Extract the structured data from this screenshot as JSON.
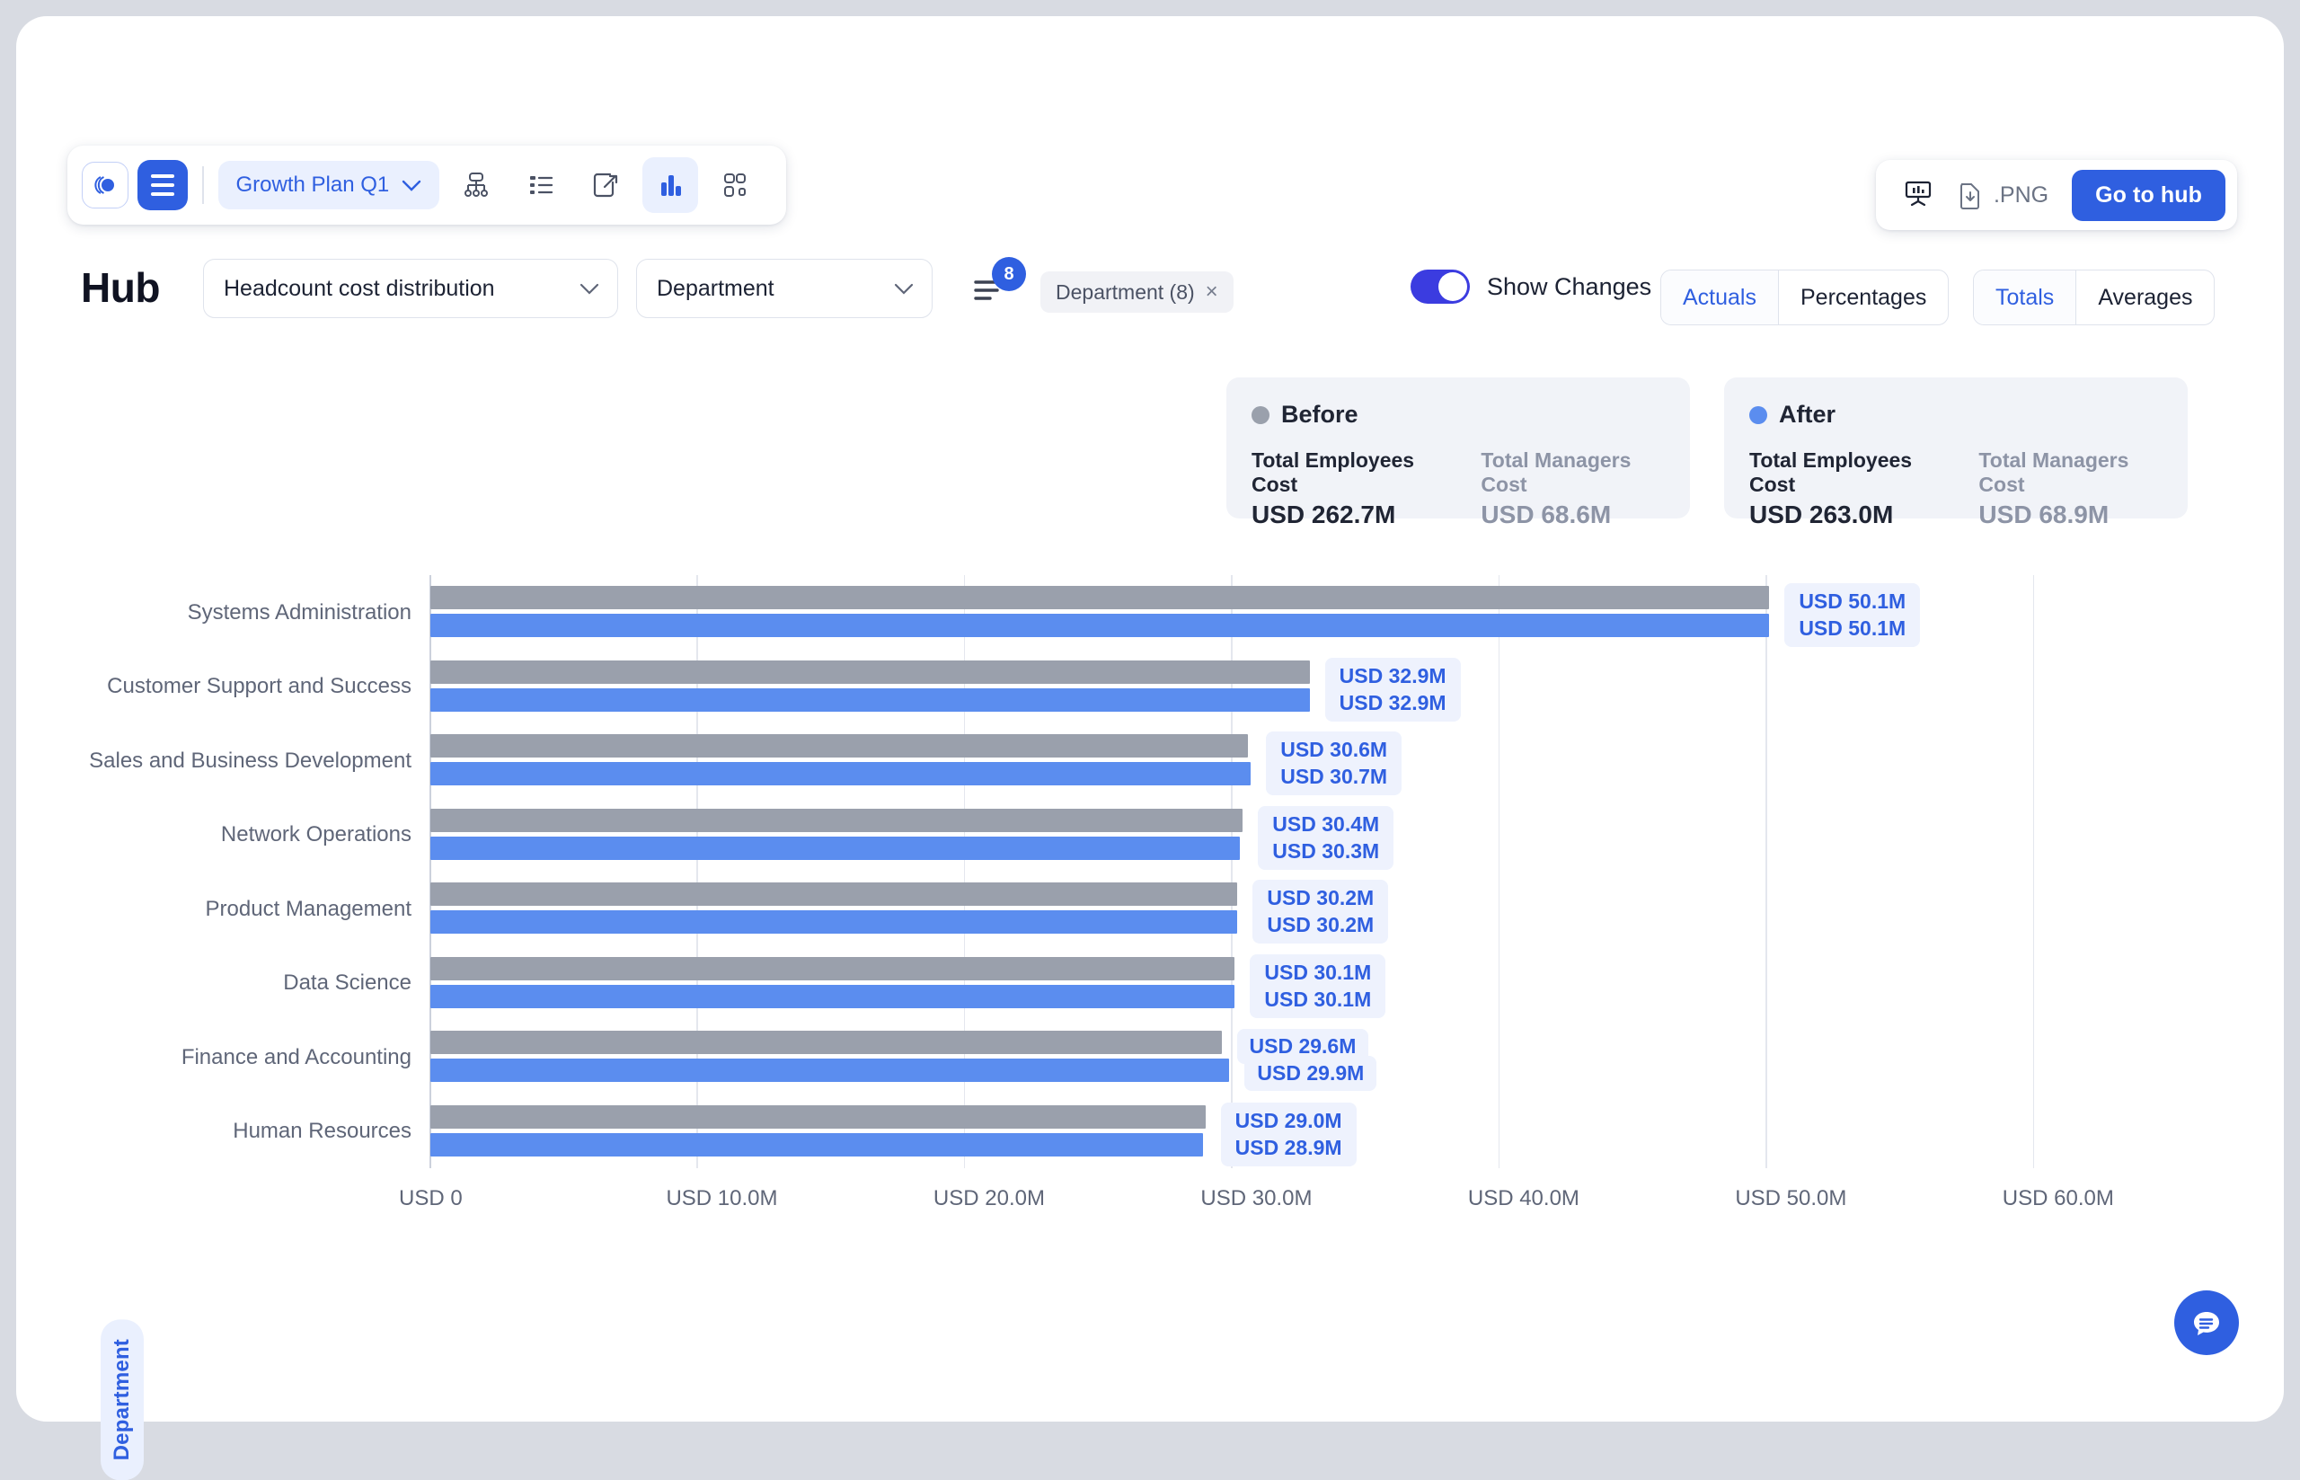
{
  "toolbar": {
    "logo_icon": "brand-logo-icon",
    "menu_icon": "hamburger-menu-icon",
    "plan_label": "Growth Plan Q1",
    "plan_chevron": "chevron-down-icon",
    "icons": [
      {
        "name": "org-chart-icon",
        "active": false
      },
      {
        "name": "list-view-icon",
        "active": false
      },
      {
        "name": "scenario-icon",
        "active": false
      },
      {
        "name": "bar-chart-icon",
        "active": true
      },
      {
        "name": "group-nodes-icon",
        "active": false
      }
    ]
  },
  "top_actions": {
    "present_icon": "presentation-icon",
    "download_icon": "file-download-icon",
    "png_label": ".PNG",
    "hub_button": "Go to hub"
  },
  "controls": {
    "page_title": "Hub",
    "metric_select": "Headcount cost distribution",
    "dimension_select": "Department",
    "filter_icon": "filter-icon",
    "filter_count": "8",
    "chip_label": "Department (8)",
    "chip_close": "×",
    "show_changes_label": "Show Changes",
    "show_changes_on": true,
    "mode_segment": {
      "options": [
        "Actuals",
        "Percentages"
      ],
      "selected": "Actuals"
    },
    "agg_segment": {
      "options": [
        "Totals",
        "Averages"
      ],
      "selected": "Totals"
    }
  },
  "summary": {
    "before": {
      "title": "Before",
      "dot_color": "#9aa0ac",
      "employees_key": "Total Employees Cost",
      "employees_value": "USD 262.7M",
      "managers_key": "Total Managers Cost",
      "managers_value": "USD 68.6M"
    },
    "after": {
      "title": "After",
      "dot_color": "#5b8def",
      "employees_key": "Total Employees Cost",
      "employees_value": "USD 263.0M",
      "managers_key": "Total Managers Cost",
      "managers_value": "USD 68.9M"
    }
  },
  "chart_data": {
    "type": "bar",
    "orientation": "horizontal",
    "title": "",
    "xlabel": "",
    "ylabel": "Department",
    "xlim": [
      0,
      63.2
    ],
    "grid": true,
    "xticks": [
      "USD 0",
      "USD 10.0M",
      "USD 20.0M",
      "USD 30.0M",
      "USD 40.0M",
      "USD 50.0M",
      "USD 60.0M"
    ],
    "xtick_values": [
      0,
      10,
      20,
      30,
      40,
      50,
      60
    ],
    "categories": [
      "Systems Administration",
      "Customer Support and Success",
      "Sales and Business Development",
      "Network Operations",
      "Product Management",
      "Data Science",
      "Finance and Accounting",
      "Human Resources"
    ],
    "series": [
      {
        "name": "Before",
        "color": "#9aa0ac",
        "values": [
          50.1,
          32.9,
          30.6,
          30.4,
          30.2,
          30.1,
          29.6,
          29.0
        ],
        "labels": [
          "USD 50.1M",
          "USD 32.9M",
          "USD 30.6M",
          "USD 30.4M",
          "USD 30.2M",
          "USD 30.1M",
          "USD 29.6M",
          "USD 29.0M"
        ]
      },
      {
        "name": "After",
        "color": "#5b8def",
        "values": [
          50.1,
          32.9,
          30.7,
          30.3,
          30.2,
          30.1,
          29.9,
          28.9
        ],
        "labels": [
          "USD 50.1M",
          "USD 32.9M",
          "USD 30.7M",
          "USD 30.3M",
          "USD 30.2M",
          "USD 30.1M",
          "USD 29.9M",
          "USD 28.9M"
        ]
      }
    ],
    "label_grouped": [
      true,
      true,
      true,
      true,
      true,
      true,
      false,
      true
    ]
  },
  "fab": {
    "icon": "chat-bubble-icon"
  }
}
